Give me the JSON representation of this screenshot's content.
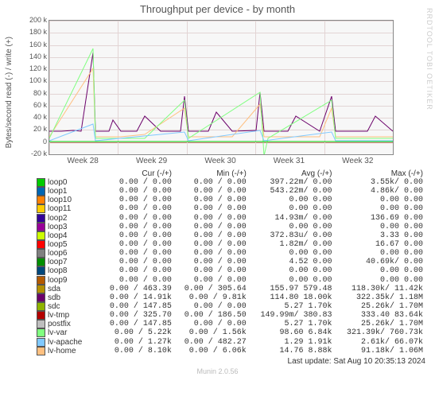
{
  "title": "Throughput per device - by month",
  "ylabel": "Bytes/second read (-) / write (+)",
  "watermark": "RRDTOOL TOBI OETIKER",
  "footer": "Last update: Sat Aug 10 20:35:13 2024",
  "munin_version": "Munin 2.0.56",
  "chart_data": {
    "type": "line",
    "ylim": [
      -20000,
      200000
    ],
    "yticks": [
      "-20 k",
      "0",
      "20 k",
      "40 k",
      "60 k",
      "80 k",
      "100 k",
      "120 k",
      "140 k",
      "160 k",
      "180 k",
      "200 k"
    ],
    "xticks": [
      "Week 28",
      "Week 29",
      "Week 30",
      "Week 31",
      "Week 32"
    ],
    "headers": [
      "",
      "Cur (-/+)",
      "Min (-/+)",
      "Avg (-/+)",
      "Max (-/+)"
    ],
    "series": [
      {
        "name": "loop0",
        "color": "#00cc00",
        "cur_r": "0.00",
        "cur_w": "0.00",
        "min_r": "0.00",
        "min_w": "0.00",
        "avg_r": "397.22m/",
        "avg_w": "0.00",
        "max_r": "3.55k/",
        "max_w": "0.00"
      },
      {
        "name": "loop1",
        "color": "#0066b3",
        "cur_r": "0.00",
        "cur_w": "0.00",
        "min_r": "0.00",
        "min_w": "0.00",
        "avg_r": "543.22m/",
        "avg_w": "0.00",
        "max_r": "4.86k/",
        "max_w": "0.00"
      },
      {
        "name": "loop10",
        "color": "#ff8000",
        "cur_r": "0.00",
        "cur_w": "0.00",
        "min_r": "0.00",
        "min_w": "0.00",
        "avg_r": "0.00",
        "avg_w": "0.00",
        "max_r": "0.00",
        "max_w": "0.00"
      },
      {
        "name": "loop11",
        "color": "#ffcc00",
        "cur_r": "0.00",
        "cur_w": "0.00",
        "min_r": "0.00",
        "min_w": "0.00",
        "avg_r": "0.00",
        "avg_w": "0.00",
        "max_r": "0.00",
        "max_w": "0.00"
      },
      {
        "name": "loop2",
        "color": "#330099",
        "cur_r": "0.00",
        "cur_w": "0.00",
        "min_r": "0.00",
        "min_w": "0.00",
        "avg_r": "14.93m/",
        "avg_w": "0.00",
        "max_r": "136.69",
        "max_w": "0.00"
      },
      {
        "name": "loop3",
        "color": "#990099",
        "cur_r": "0.00",
        "cur_w": "0.00",
        "min_r": "0.00",
        "min_w": "0.00",
        "avg_r": "0.00",
        "avg_w": "0.00",
        "max_r": "0.00",
        "max_w": "0.00"
      },
      {
        "name": "loop4",
        "color": "#ccff00",
        "cur_r": "0.00",
        "cur_w": "0.00",
        "min_r": "0.00",
        "min_w": "0.00",
        "avg_r": "372.83u/",
        "avg_w": "0.00",
        "max_r": "3.33",
        "max_w": "0.00"
      },
      {
        "name": "loop5",
        "color": "#ff0000",
        "cur_r": "0.00",
        "cur_w": "0.00",
        "min_r": "0.00",
        "min_w": "0.00",
        "avg_r": "1.82m/",
        "avg_w": "0.00",
        "max_r": "16.67",
        "max_w": "0.00"
      },
      {
        "name": "loop6",
        "color": "#808080",
        "cur_r": "0.00",
        "cur_w": "0.00",
        "min_r": "0.00",
        "min_w": "0.00",
        "avg_r": "0.00",
        "avg_w": "0.00",
        "max_r": "0.00",
        "max_w": "0.00"
      },
      {
        "name": "loop7",
        "color": "#008f00",
        "cur_r": "0.00",
        "cur_w": "0.00",
        "min_r": "0.00",
        "min_w": "0.00",
        "avg_r": "4.52",
        "avg_w": "0.00",
        "max_r": "40.69k/",
        "max_w": "0.00"
      },
      {
        "name": "loop8",
        "color": "#00487d",
        "cur_r": "0.00",
        "cur_w": "0.00",
        "min_r": "0.00",
        "min_w": "0.00",
        "avg_r": "0.00",
        "avg_w": "0.00",
        "max_r": "0.00",
        "max_w": "0.00"
      },
      {
        "name": "loop9",
        "color": "#b35a00",
        "cur_r": "0.00",
        "cur_w": "0.00",
        "min_r": "0.00",
        "min_w": "0.00",
        "avg_r": "0.00",
        "avg_w": "0.00",
        "max_r": "0.00",
        "max_w": "0.00"
      },
      {
        "name": "sda",
        "color": "#b38f00",
        "cur_r": "0.00",
        "cur_w": "463.39",
        "min_r": "0.00",
        "min_w": "305.64",
        "avg_r": "155.97",
        "avg_w": "579.48",
        "max_r": "118.30k/",
        "max_w": "11.42k"
      },
      {
        "name": "sdb",
        "color": "#6b006b",
        "cur_r": "0.00",
        "cur_w": "14.91k",
        "min_r": "0.00",
        "min_w": "9.81k",
        "avg_r": "114.80",
        "avg_w": "18.00k",
        "max_r": "322.35k/",
        "max_w": "1.18M"
      },
      {
        "name": "sdc",
        "color": "#8fb300",
        "cur_r": "0.00",
        "cur_w": "147.85",
        "min_r": "0.00",
        "min_w": "0.00",
        "avg_r": "5.27",
        "avg_w": "1.70k",
        "max_r": "25.26k/",
        "max_w": "1.70M"
      },
      {
        "name": "lv-tmp",
        "color": "#b30000",
        "cur_r": "0.00",
        "cur_w": "325.70",
        "min_r": "0.00",
        "min_w": "186.50",
        "avg_r": "149.99m/",
        "avg_w": "380.83",
        "max_r": "333.40",
        "max_w": "83.64k"
      },
      {
        "name": "postfix",
        "color": "#bebebe",
        "cur_r": "0.00",
        "cur_w": "147.85",
        "min_r": "0.00",
        "min_w": "0.00",
        "avg_r": "5.27",
        "avg_w": "1.70k",
        "max_r": "25.26k/",
        "max_w": "1.70M"
      },
      {
        "name": "lv-var",
        "color": "#80ff80",
        "cur_r": "0.00",
        "cur_w": "5.22k",
        "min_r": "0.00",
        "min_w": "1.56k",
        "avg_r": "98.60",
        "avg_w": "6.84k",
        "max_r": "321.39k/",
        "max_w": "760.73k"
      },
      {
        "name": "lv-apache",
        "color": "#80c9ff",
        "cur_r": "0.00",
        "cur_w": "1.27k",
        "min_r": "0.00",
        "min_w": "482.27",
        "avg_r": "1.29",
        "avg_w": "1.91k",
        "max_r": "2.61k/",
        "max_w": "66.07k"
      },
      {
        "name": "lv-home",
        "color": "#ffc080",
        "cur_r": "0.00",
        "cur_w": "8.10k",
        "min_r": "0.00",
        "min_w": "6.06k",
        "avg_r": "14.76",
        "avg_w": "8.88k",
        "max_r": "91.18k/",
        "max_w": "1.06M"
      }
    ]
  }
}
